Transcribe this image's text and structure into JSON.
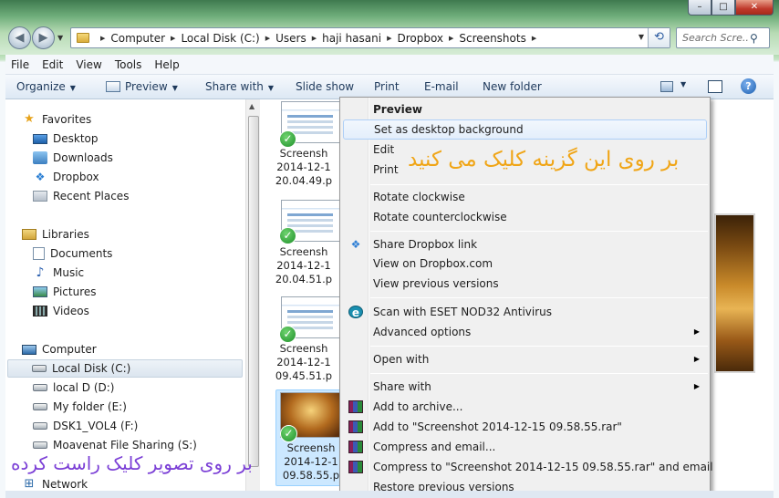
{
  "window_controls": {
    "minimize": "–",
    "maximize": "□",
    "close": "✕"
  },
  "nav": {
    "back_icon": "back-arrow-icon",
    "forward_icon": "forward-arrow-icon"
  },
  "address_bar": {
    "breadcrumbs": [
      "Computer",
      "Local Disk (C:)",
      "Users",
      "haji hasani",
      "Dropbox",
      "Screenshots"
    ]
  },
  "search": {
    "placeholder": "Search Scre..."
  },
  "menubar": [
    "File",
    "Edit",
    "View",
    "Tools",
    "Help"
  ],
  "commandbar": {
    "organize": "Organize",
    "preview": "Preview",
    "share_with": "Share with",
    "slide_show": "Slide show",
    "print": "Print",
    "email": "E-mail",
    "new_folder": "New folder"
  },
  "navpane": {
    "favorites": "Favorites",
    "favorites_items": [
      "Desktop",
      "Downloads",
      "Dropbox",
      "Recent Places"
    ],
    "libraries": "Libraries",
    "libraries_items": [
      "Documents",
      "Music",
      "Pictures",
      "Videos"
    ],
    "computer": "Computer",
    "computer_items": [
      "Local Disk (C:)",
      "local D (D:)",
      "My folder (E:)",
      "DSK1_VOL4 (F:)",
      "Moavenat File Sharing (S:)"
    ],
    "network": "Network"
  },
  "files": [
    {
      "line1": "Screensh",
      "line2": "2014-12-1",
      "line3": "20.04.49.p"
    },
    {
      "line1": "Screensh",
      "line2": "2014-12-1",
      "line3": "20.04.51.p"
    },
    {
      "line1": "Screensh",
      "line2": "2014-12-1",
      "line3": "09.45.51.p"
    },
    {
      "line1": "Screensh",
      "line2": "2014-12-1",
      "line3": "09.58.55.p"
    }
  ],
  "context_menu": {
    "preview": "Preview",
    "set_desktop_bg": "Set as desktop background",
    "edit": "Edit",
    "print": "Print",
    "rotate_cw": "Rotate clockwise",
    "rotate_ccw": "Rotate counterclockwise",
    "share_dropbox": "Share Dropbox link",
    "view_dropbox": "View on Dropbox.com",
    "view_prev": "View previous versions",
    "scan_eset": "Scan with ESET NOD32 Antivirus",
    "advanced": "Advanced options",
    "open_with": "Open with",
    "share_with": "Share with",
    "add_archive": "Add to archive...",
    "add_rar": "Add to \"Screenshot 2014-12-15 09.58.55.rar\"",
    "compress_email": "Compress and email...",
    "compress_rar_email": "Compress to \"Screenshot 2014-12-15 09.58.55.rar\" and email",
    "restore_prev": "Restore previous versions"
  },
  "annotations": {
    "menu_note": "بر روی این گزینه کلیک می کنید",
    "image_note": "بر روی تصویر کلیک راست کرده"
  }
}
